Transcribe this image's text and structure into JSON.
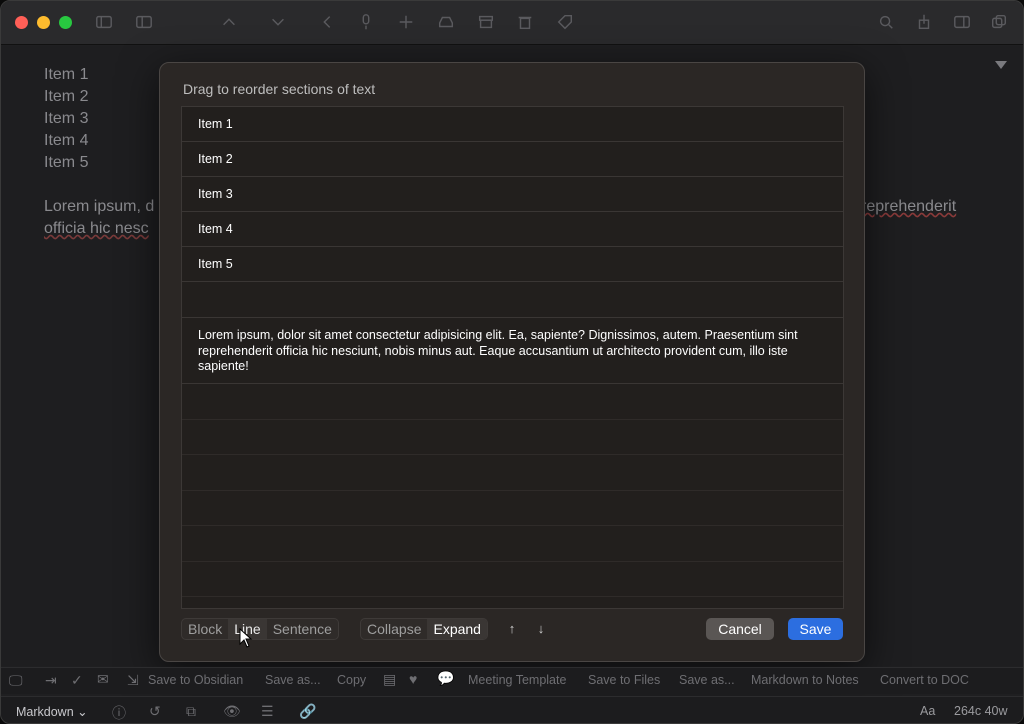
{
  "editor": {
    "lines": [
      "Item 1",
      "Item 2",
      "Item 3",
      "Item 4",
      "Item 5"
    ],
    "para_left_1": "Lorem ipsum, d",
    "para_left_2": "officia hic nesc",
    "para_right_1": "reprehenderit"
  },
  "dialog": {
    "title": "Drag to reorder sections of text",
    "rows": [
      "Item 1",
      "Item 2",
      "Item 3",
      "Item 4",
      "Item 5"
    ],
    "paragraph": "Lorem ipsum, dolor sit amet consectetur adipisicing elit. Ea, sapiente? Dignissimos, autem. Praesentium sint reprehenderit officia hic nesciunt, nobis minus aut. Eaque accusantium ut architecto provident cum, illo iste sapiente!",
    "split_modes": [
      "Block",
      "Line",
      "Sentence"
    ],
    "view_modes": [
      "Collapse",
      "Expand"
    ],
    "move_up": "↑",
    "move_down": "↓",
    "cancel_label": "Cancel",
    "save_label": "Save"
  },
  "toolbar": {
    "save_obsidian": "Save to Obsidian",
    "save_as_1": "Save as...",
    "copy": "Copy",
    "meeting_template": "Meeting Template",
    "save_files": "Save to Files",
    "save_as_2": "Save as...",
    "md_notes": "Markdown to Notes",
    "convert_doc": "Convert to DOC"
  },
  "status": {
    "syntax": "Markdown",
    "font_label": "Aa",
    "counts": "264c 40w"
  },
  "colors": {
    "accent": "#2c6ee0",
    "close": "#ff5f57",
    "minimize": "#febc2e",
    "maximize": "#28c840"
  }
}
